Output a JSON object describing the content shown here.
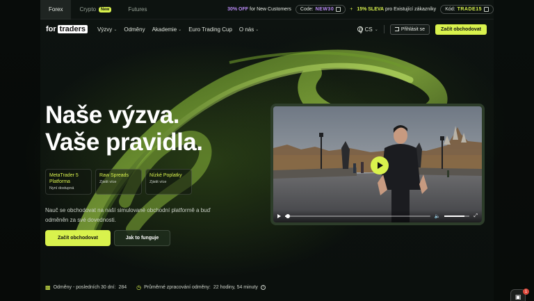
{
  "market_tabs": [
    {
      "label": "Forex",
      "active": true
    },
    {
      "label": "Crypto",
      "badge": "New"
    },
    {
      "label": "Futures"
    }
  ],
  "promo": {
    "offer1_highlight": "30% OFF",
    "offer1_text": "for New Customers",
    "code1_label": "Code:",
    "code1_value": "NEW30",
    "separator": "+",
    "offer2_highlight": "15% SLEVA",
    "offer2_text": "pro Existující zákazníky",
    "code2_label": "Kód:",
    "code2_value": "TRADE15"
  },
  "logo": {
    "part1": "for",
    "part2": "traders"
  },
  "nav": {
    "links": [
      {
        "label": "Výzvy",
        "dropdown": true
      },
      {
        "label": "Odměny",
        "dropdown": false
      },
      {
        "label": "Akademie",
        "dropdown": true
      },
      {
        "label": "Euro Trading Cup",
        "dropdown": false
      },
      {
        "label": "O nás",
        "dropdown": true
      }
    ],
    "language": "CS",
    "login_label": "Přihlásit se",
    "start_label": "Začít obchodovat"
  },
  "hero": {
    "title_line1": "Naše výzva.",
    "title_line2": "Vaše pravidla.",
    "features": [
      {
        "title": "MetaTrader 5 Platforma",
        "subtitle": "Nyní dostupná"
      },
      {
        "title": "Raw Spreads",
        "subtitle": "Zjistit více"
      },
      {
        "title": "Nízké Poplatky",
        "subtitle": "Zjistit více"
      }
    ],
    "description": "Nauč se obchodovat na naší simulované obchodní platformě a buď odměněn za své dovednosti.",
    "primary_button": "Začít obchodovat",
    "secondary_button": "Jak to funguje"
  },
  "stats": {
    "rewards_label": "Odměny - posledních 30 dní:",
    "rewards_value": "284",
    "processing_label": "Průměrné zpracování odměny:",
    "processing_value": "22 hodiny, 54 minuty"
  },
  "video": {
    "progress": 0.02,
    "volume": 0.8
  },
  "chat": {
    "badge_count": "1"
  },
  "colors": {
    "accent": "#d9f24d",
    "promo_purple": "#b98af5",
    "background": "#0c110e"
  }
}
